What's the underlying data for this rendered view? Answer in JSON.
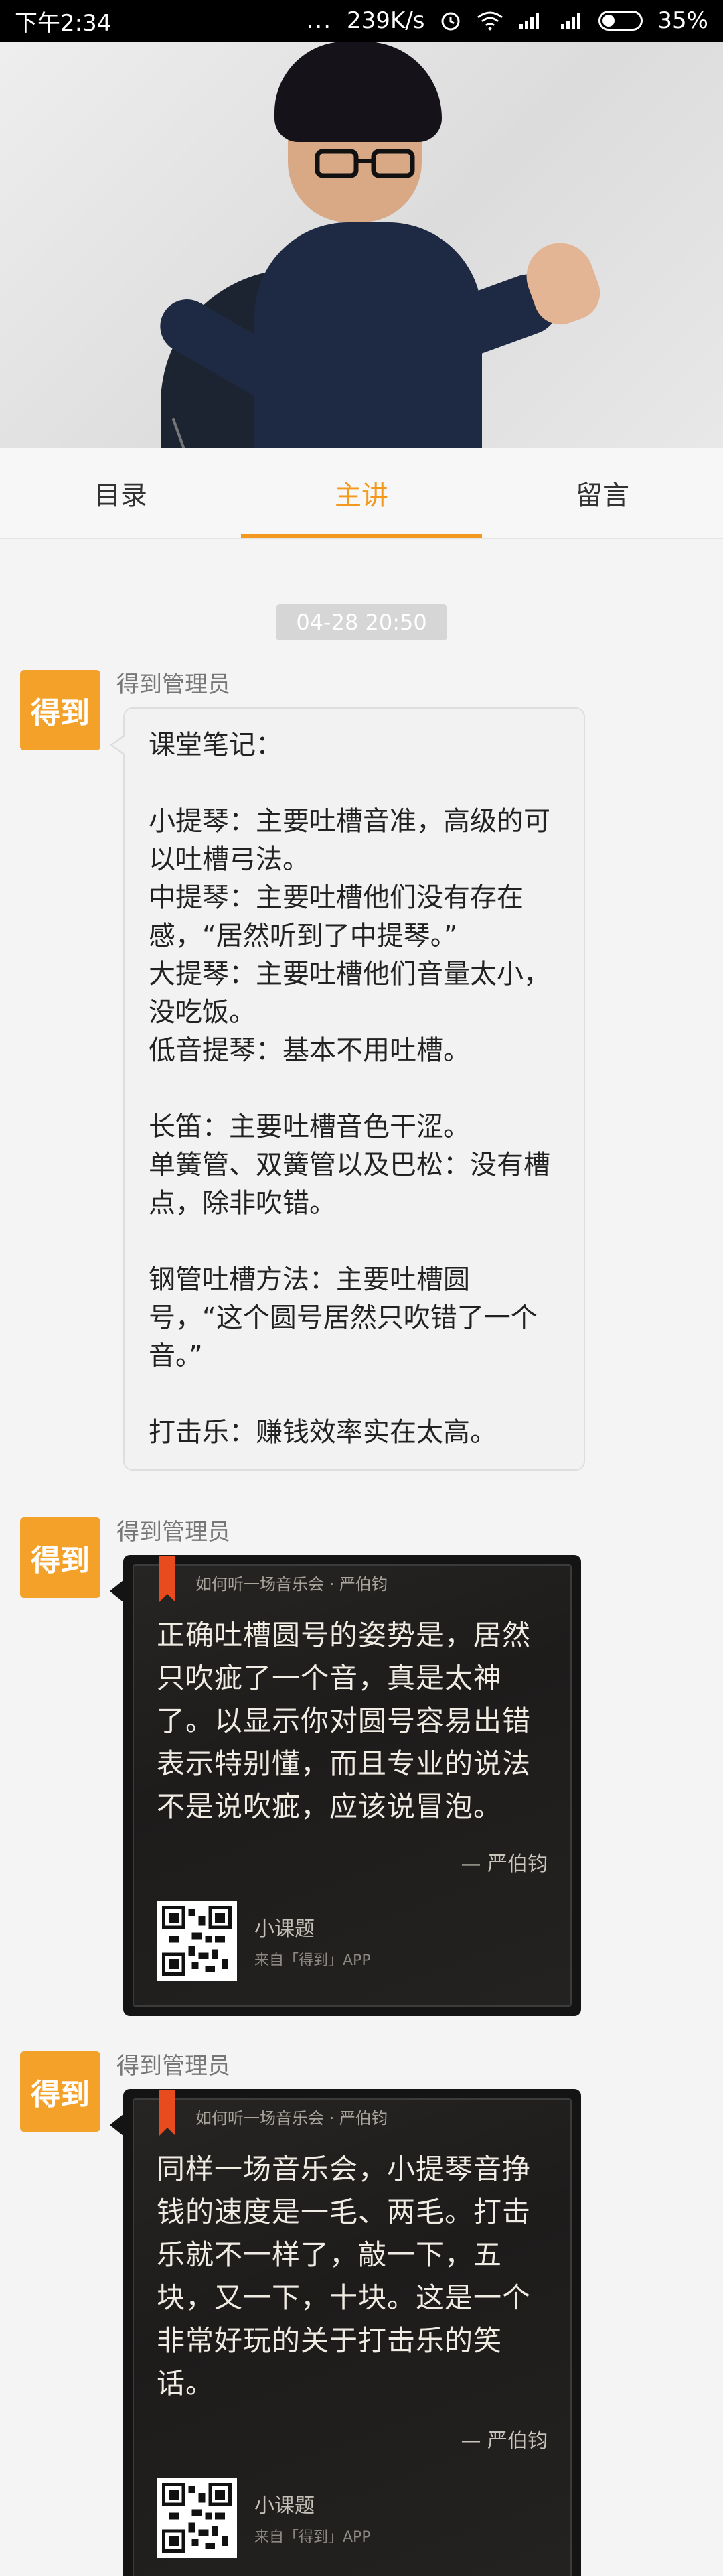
{
  "status_bar": {
    "time": "下午2:34",
    "dots": "...",
    "speed": "239K/s",
    "network": "4G 1X",
    "battery": "35%"
  },
  "hero": {
    "image_icon": "lecturer-portrait"
  },
  "tabs": [
    {
      "label": "目录",
      "active": false
    },
    {
      "label": "主讲",
      "active": true
    },
    {
      "label": "留言",
      "active": false
    }
  ],
  "timestamp": "04-28 20:50",
  "messages": [
    {
      "avatar_text": "得到",
      "sender": "得到管理员",
      "text": "课堂笔记：\n\n小提琴：主要吐槽音准，高级的可以吐槽弓法。\n中提琴：主要吐槽他们没有存在感，“居然听到了中提琴。”\n大提琴：主要吐槽他们音量太小，没吃饭。\n低音提琴：基本不用吐槽。\n\n长笛：主要吐槽音色干涩。\n单簧管、双簧管以及巴松：没有槽点，除非吹错。\n\n钢管吐槽方法：主要吐槽圆号，“这个圆号居然只吹错了一个音。”\n\n打击乐：赚钱效率实在太高。"
    },
    {
      "avatar_text": "得到",
      "sender": "得到管理员",
      "card": {
        "tag": "如何听一场音乐会 · 严伯钧",
        "quote": "正确吐槽圆号的姿势是，居然只吹疵了一个音，真是太神了。以显示你对圆号容易出错表示特别懂，而且专业的说法不是说吹疵，应该说冒泡。",
        "author": "— 严伯钧",
        "footer_title": "小课题",
        "footer_sub": "来自「得到」APP"
      }
    },
    {
      "avatar_text": "得到",
      "sender": "得到管理员",
      "card": {
        "tag": "如何听一场音乐会 · 严伯钧",
        "quote": "同样一场音乐会，小提琴音挣钱的速度是一毛、两毛。打击乐就不一样了，敲一下，五块，又一下，十块。这是一个非常好玩的关于打击乐的笑话。",
        "author": "— 严伯钧",
        "footer_title": "小课题",
        "footer_sub": "来自「得到」APP"
      }
    }
  ],
  "colors": {
    "accent": "#f39a1e",
    "avatar": "#f4a12a",
    "bookmark": "#e84c1e"
  }
}
